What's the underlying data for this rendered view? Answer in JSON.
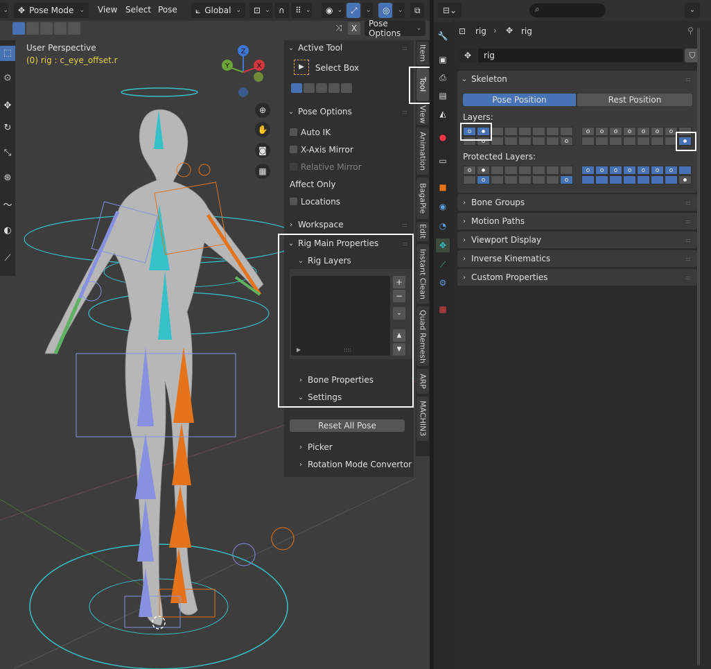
{
  "header": {
    "mode": "Pose Mode",
    "menus": [
      "View",
      "Select",
      "Pose"
    ],
    "transform_orientation": "Global",
    "pose_options_label": "Pose Options",
    "x_label": "X"
  },
  "viewport": {
    "perspective": "User Perspective",
    "active_object": "(0) rig : c_eye_offset.r",
    "gizmo_axes": {
      "z": "Z",
      "y": "Y",
      "x": "X"
    }
  },
  "npanel": {
    "active_tool_title": "Active Tool",
    "select_box_label": "Select Box",
    "pose_options_title": "Pose Options",
    "auto_ik": "Auto IK",
    "x_axis_mirror": "X-Axis Mirror",
    "relative_mirror": "Relative Mirror",
    "affect_only": "Affect Only",
    "locations": "Locations",
    "workspace": "Workspace",
    "rig_main_properties": "Rig Main Properties",
    "rig_layers": "Rig Layers",
    "bone_properties": "Bone Properties",
    "settings": "Settings",
    "reset_all_pose": "Reset All Pose",
    "picker": "Picker",
    "rotation_mode_convertor": "Rotation Mode Convertor"
  },
  "vtabs": [
    "Item",
    "Tool",
    "View",
    "Animation",
    "BagaPie",
    "Edit",
    "Instant Clean",
    "Quad Remesh",
    "ARP",
    "MACHIN3"
  ],
  "properties": {
    "breadcrumb": [
      "rig",
      "rig"
    ],
    "data_name": "rig",
    "skeleton_title": "Skeleton",
    "pose_position": "Pose Position",
    "rest_position": "Rest Position",
    "layers_label": "Layers:",
    "protected_layers_label": "Protected Layers:",
    "sections": [
      "Bone Groups",
      "Motion Paths",
      "Viewport Display",
      "Inverse Kinematics",
      "Custom Properties"
    ]
  },
  "colors": {
    "accent_blue": "#4772b3",
    "bone_orange": "#e4731a",
    "bone_blue": "#8791e0",
    "cyan": "#36c1c9",
    "yellow_text": "#e6d43e"
  }
}
